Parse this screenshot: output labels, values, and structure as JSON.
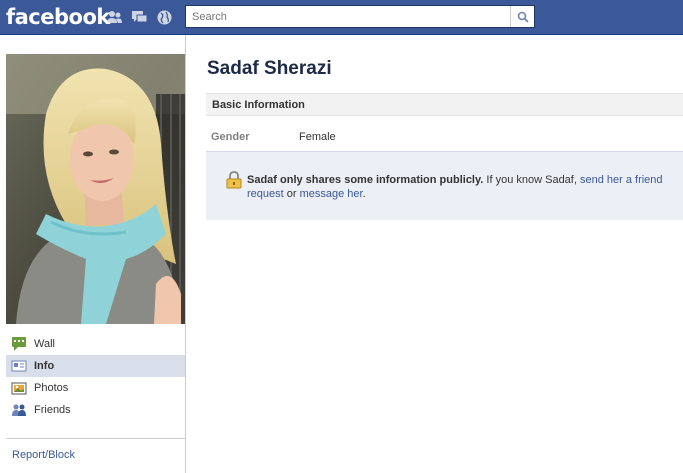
{
  "header": {
    "logo": "facebook",
    "search_placeholder": "Search"
  },
  "sidebar": {
    "nav": [
      {
        "label": "Wall",
        "icon": "wall-icon"
      },
      {
        "label": "Info",
        "icon": "info-icon"
      },
      {
        "label": "Photos",
        "icon": "photos-icon"
      },
      {
        "label": "Friends",
        "icon": "friends-icon"
      }
    ],
    "report_label": "Report/Block"
  },
  "profile": {
    "name": "Sadaf Sherazi",
    "section_title": "Basic Information",
    "gender_label": "Gender",
    "gender_value": "Female"
  },
  "notice": {
    "bold": "Sadaf only shares some information publicly.",
    "text1": " If you know Sadaf, ",
    "link1": "send her a friend request",
    "text2": " or ",
    "link2": "message her",
    "text3": "."
  },
  "colors": {
    "brand_blue": "#3b5998",
    "active_nav": "#d8dfea",
    "notice_bg": "#eceff5"
  }
}
